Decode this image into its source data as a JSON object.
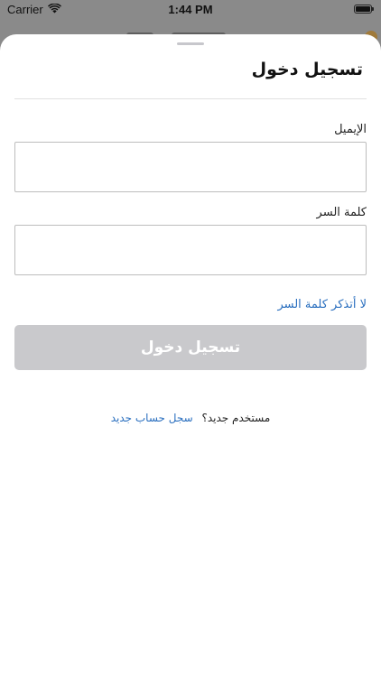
{
  "status_bar": {
    "carrier": "Carrier",
    "time": "1:44 PM",
    "wifi_icon": "wifi-icon",
    "battery_icon": "battery-icon"
  },
  "sheet": {
    "title": "تسجيل دخول"
  },
  "form": {
    "email_label": "الإيميل",
    "email_value": "",
    "password_label": "كلمة السر",
    "password_value": "",
    "forgot_password": "لا أتذكر كلمة السر",
    "login_button": "تسجيل دخول"
  },
  "signup": {
    "prompt": "مستخدم جديد؟",
    "link": "سجل حساب جديد"
  },
  "colors": {
    "link": "#2a6fbf",
    "button_disabled": "#c9c9cc",
    "input_border": "#bdbdbd"
  }
}
